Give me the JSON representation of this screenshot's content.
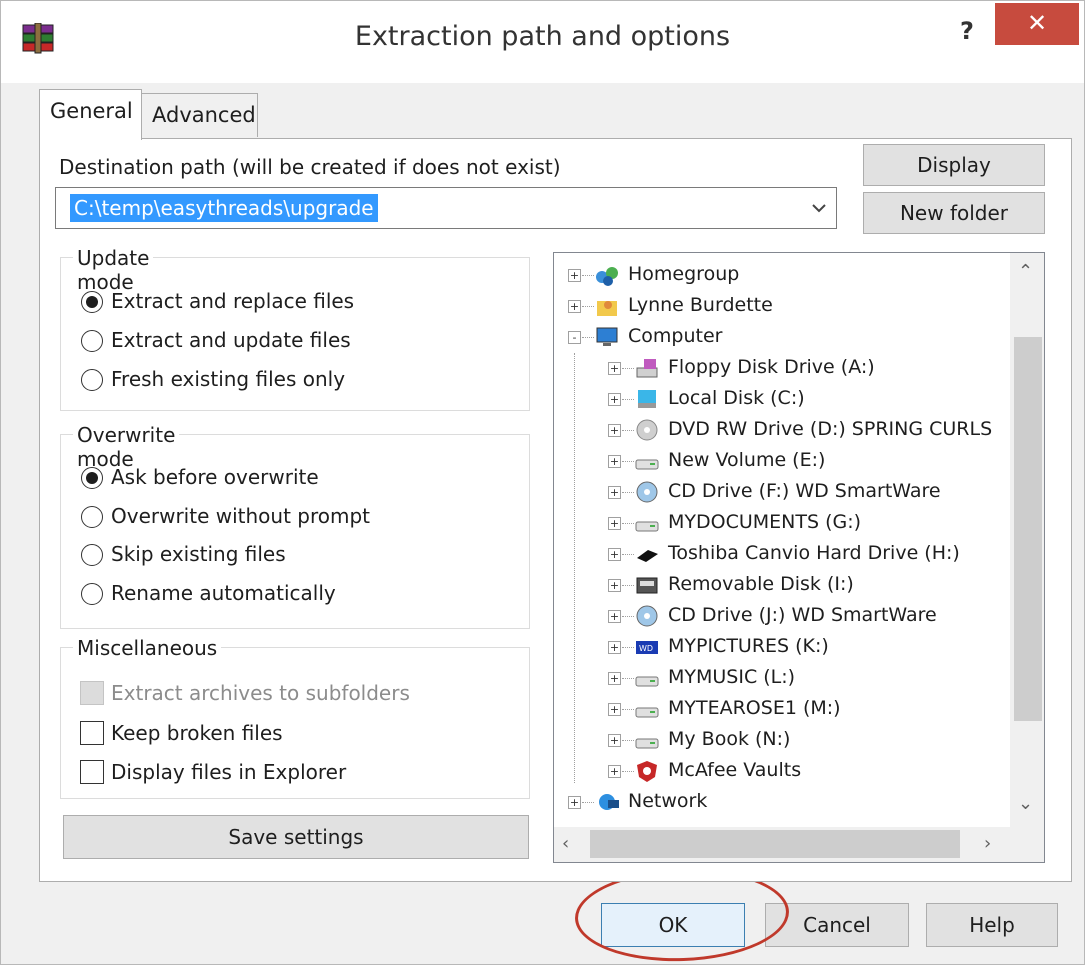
{
  "window": {
    "title": "Extraction path and options",
    "help_label": "?",
    "close_label": "✕"
  },
  "tabs": [
    {
      "label": "General"
    },
    {
      "label": "Advanced"
    }
  ],
  "destination": {
    "label": "Destination path (will be created if does not exist)",
    "value": "C:\\temp\\easythreads\\upgrade"
  },
  "buttons": {
    "display": "Display",
    "new_folder": "New folder",
    "save_settings": "Save settings",
    "ok": "OK",
    "cancel": "Cancel",
    "help": "Help"
  },
  "update_mode": {
    "title": "Update mode",
    "options": [
      {
        "label": "Extract and replace files",
        "checked": true
      },
      {
        "label": "Extract and update files",
        "checked": false
      },
      {
        "label": "Fresh existing files only",
        "checked": false
      }
    ]
  },
  "overwrite_mode": {
    "title": "Overwrite mode",
    "options": [
      {
        "label": "Ask before overwrite",
        "checked": true
      },
      {
        "label": "Overwrite without prompt",
        "checked": false
      },
      {
        "label": "Skip existing files",
        "checked": false
      },
      {
        "label": "Rename automatically",
        "checked": false
      }
    ]
  },
  "misc": {
    "title": "Miscellaneous",
    "options": [
      {
        "label": "Extract archives to subfolders",
        "checked": false,
        "disabled": true
      },
      {
        "label": "Keep broken files",
        "checked": false,
        "disabled": false
      },
      {
        "label": "Display files in Explorer",
        "checked": false,
        "disabled": false
      }
    ]
  },
  "tree": [
    {
      "label": "Homegroup",
      "icon": "homegroup-icon",
      "level": 0,
      "expander": "+"
    },
    {
      "label": "Lynne Burdette",
      "icon": "user-folder-icon",
      "level": 0,
      "expander": "+"
    },
    {
      "label": "Computer",
      "icon": "computer-icon",
      "level": 0,
      "expander": "-"
    },
    {
      "label": "Floppy Disk Drive (A:)",
      "icon": "floppy-drive-icon",
      "level": 1,
      "expander": "+"
    },
    {
      "label": "Local Disk (C:)",
      "icon": "local-disk-icon",
      "level": 1,
      "expander": "+"
    },
    {
      "label": "DVD RW Drive (D:) SPRING CURLS",
      "icon": "dvd-drive-icon",
      "level": 1,
      "expander": "+"
    },
    {
      "label": "New Volume (E:)",
      "icon": "hard-drive-icon",
      "level": 1,
      "expander": "+"
    },
    {
      "label": "CD Drive (F:) WD SmartWare",
      "icon": "cd-drive-icon",
      "level": 1,
      "expander": "+"
    },
    {
      "label": "MYDOCUMENTS (G:)",
      "icon": "hard-drive-icon",
      "level": 1,
      "expander": "+"
    },
    {
      "label": "Toshiba Canvio Hard Drive (H:)",
      "icon": "external-drive-icon",
      "level": 1,
      "expander": "+"
    },
    {
      "label": "Removable Disk (I:)",
      "icon": "removable-disk-icon",
      "level": 1,
      "expander": "+"
    },
    {
      "label": "CD Drive (J:) WD SmartWare",
      "icon": "cd-drive-icon",
      "level": 1,
      "expander": "+"
    },
    {
      "label": "MYPICTURES (K:)",
      "icon": "wd-drive-icon",
      "level": 1,
      "expander": "+"
    },
    {
      "label": "MYMUSIC (L:)",
      "icon": "hard-drive-icon",
      "level": 1,
      "expander": "+"
    },
    {
      "label": "MYTEAROSE1 (M:)",
      "icon": "hard-drive-icon",
      "level": 1,
      "expander": "+"
    },
    {
      "label": "My Book (N:)",
      "icon": "hard-drive-icon",
      "level": 1,
      "expander": "+"
    },
    {
      "label": "McAfee Vaults",
      "icon": "mcafee-vault-icon",
      "level": 1,
      "expander": "+"
    },
    {
      "label": "Network",
      "icon": "network-icon",
      "level": 0,
      "expander": "+"
    }
  ],
  "colors": {
    "selection": "#3399ff",
    "close": "#c74b3e",
    "annotation_ring": "#c0392b"
  }
}
